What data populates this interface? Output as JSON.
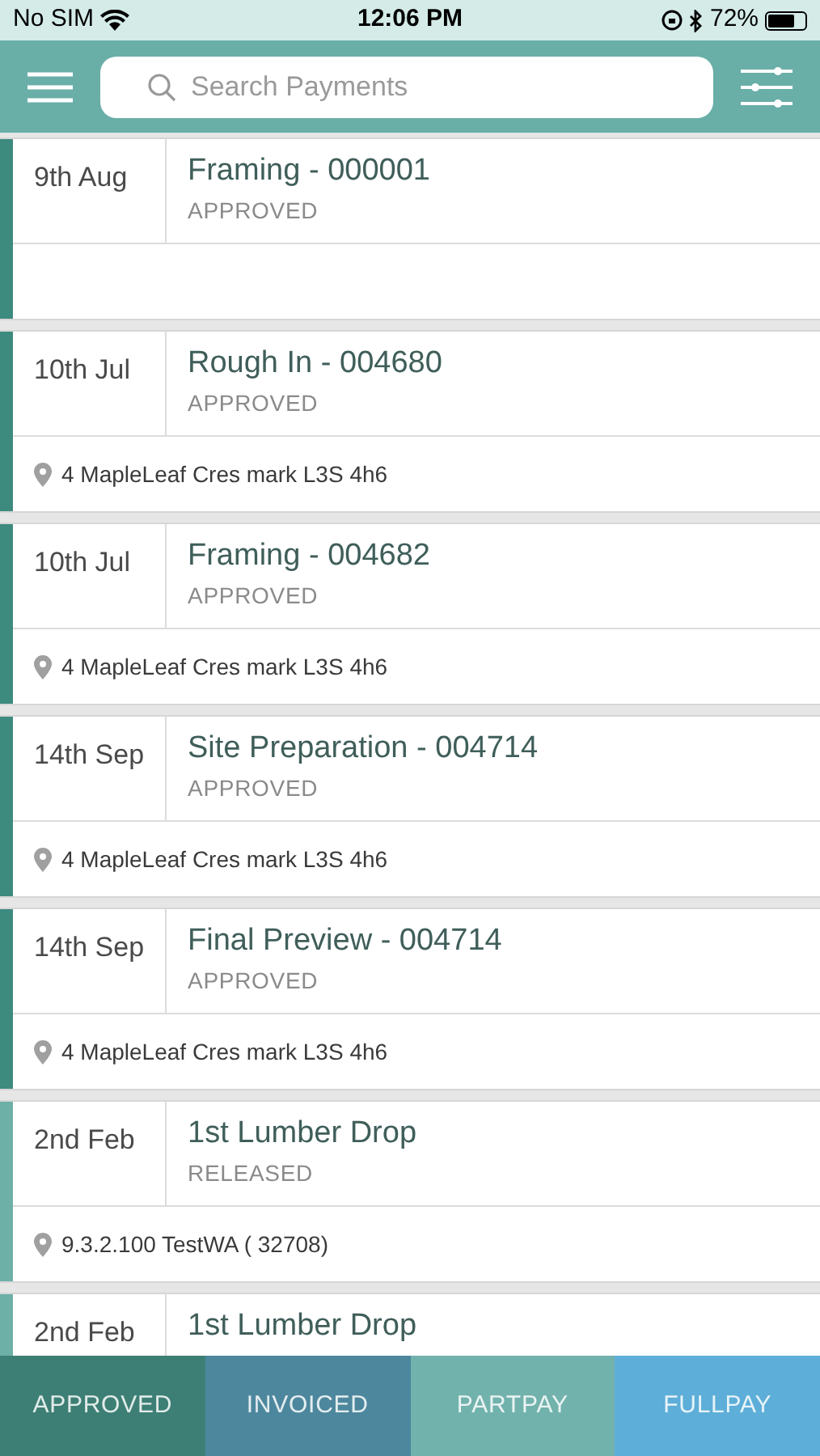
{
  "status_bar": {
    "carrier": "No SIM",
    "time": "12:06 PM",
    "battery": "72%"
  },
  "search": {
    "placeholder": "Search Payments"
  },
  "payments": [
    {
      "date": "9th Aug",
      "title": "Framing - 000001",
      "status": "APPROVED",
      "color": "#3d8a7e"
    },
    {
      "date": "10th Jul",
      "title": "Rough In - 004680",
      "status": "APPROVED",
      "address": "4 MapleLeaf Cres mark L3S 4h6",
      "color": "#3d8a7e"
    },
    {
      "date": "10th Jul",
      "title": "Framing - 004682",
      "status": "APPROVED",
      "address": "4 MapleLeaf Cres mark L3S 4h6",
      "color": "#3d8a7e"
    },
    {
      "date": "14th Sep",
      "title": "Site Preparation - 004714",
      "status": "APPROVED",
      "address": "4 MapleLeaf Cres mark L3S 4h6",
      "color": "#3d8a7e"
    },
    {
      "date": "14th Sep",
      "title": "Final Preview - 004714",
      "status": "APPROVED",
      "address": "4 MapleLeaf Cres mark L3S 4h6",
      "color": "#3d8a7e"
    },
    {
      "date": "2nd Feb",
      "title": "1st Lumber Drop",
      "status": "RELEASED",
      "address": "9.3.2.100 TestWA ( 32708)",
      "color": "#6cb0a8"
    },
    {
      "date": "2nd Feb",
      "title": "1st Lumber Drop",
      "color": "#6cb0a8"
    }
  ],
  "tabs": [
    {
      "label": "APPROVED",
      "color": "#3d7f75"
    },
    {
      "label": "INVOICED",
      "color": "#4d879d"
    },
    {
      "label": "PARTPAY",
      "color": "#72b2ad"
    },
    {
      "label": "FULLPAY",
      "color": "#5daed8"
    }
  ]
}
